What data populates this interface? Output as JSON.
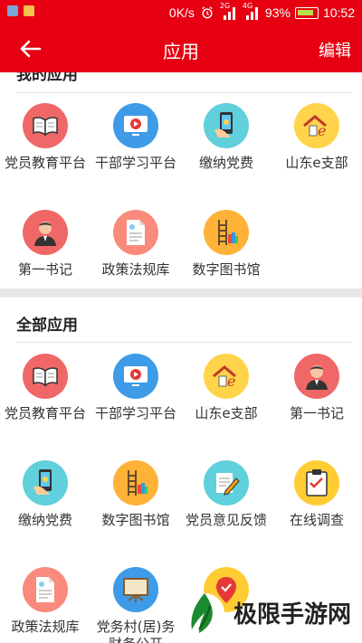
{
  "status_bar": {
    "network_speed": "0K/s",
    "signal_1_label": "2G",
    "signal_2_label": "4G",
    "battery_percent": "93%",
    "time": "10:52"
  },
  "header": {
    "title": "应用",
    "edit_label": "编辑",
    "back_icon": "arrow-left-icon"
  },
  "my_apps": {
    "section_title": "我的应用",
    "items": [
      {
        "label": "党员教育平台",
        "icon": "book-icon",
        "color": "#f06767"
      },
      {
        "label": "干部学习平台",
        "icon": "video-play-icon",
        "color": "#3d9be8"
      },
      {
        "label": "缴纳党费",
        "icon": "phone-payment-icon",
        "color": "#5fd0dc"
      },
      {
        "label": "山东e支部",
        "icon": "house-e-icon",
        "color": "#ffd44a"
      },
      {
        "label": "第一书记",
        "icon": "person-icon",
        "color": "#f06767"
      },
      {
        "label": "政策法规库",
        "icon": "document-icon",
        "color": "#f98a7c"
      },
      {
        "label": "数字图书馆",
        "icon": "bookshelf-ladder-icon",
        "color": "#ffb238"
      }
    ]
  },
  "all_apps": {
    "section_title": "全部应用",
    "items": [
      {
        "label": "党员教育平台",
        "icon": "book-icon",
        "color": "#f06767"
      },
      {
        "label": "干部学习平台",
        "icon": "video-play-icon",
        "color": "#3d9be8"
      },
      {
        "label": "山东e支部",
        "icon": "house-e-icon",
        "color": "#ffd44a"
      },
      {
        "label": "第一书记",
        "icon": "person-icon",
        "color": "#f06767"
      },
      {
        "label": "缴纳党费",
        "icon": "phone-payment-icon",
        "color": "#5fd0dc"
      },
      {
        "label": "数字图书馆",
        "icon": "bookshelf-ladder-icon",
        "color": "#ffb238"
      },
      {
        "label": "党员意见反馈",
        "icon": "pencil-paper-icon",
        "color": "#5fd0dc"
      },
      {
        "label": "在线调查",
        "icon": "clipboard-check-icon",
        "color": "#ffcc33"
      },
      {
        "label": "政策法规库",
        "icon": "document-icon",
        "color": "#f98a7c"
      },
      {
        "label": "党务村(居)务财务公开",
        "icon": "presentation-board-icon",
        "color": "#3d9be8"
      },
      {
        "label": "",
        "icon": "location-pin-icon",
        "color": "#ffcc33"
      }
    ]
  },
  "watermark": {
    "text": "极限手游网",
    "logo_icon": "green-leaf-logo"
  },
  "colors": {
    "brand_red": "#e60012",
    "divider": "#e4e4e4",
    "section_gap": "#e8e8e8"
  }
}
